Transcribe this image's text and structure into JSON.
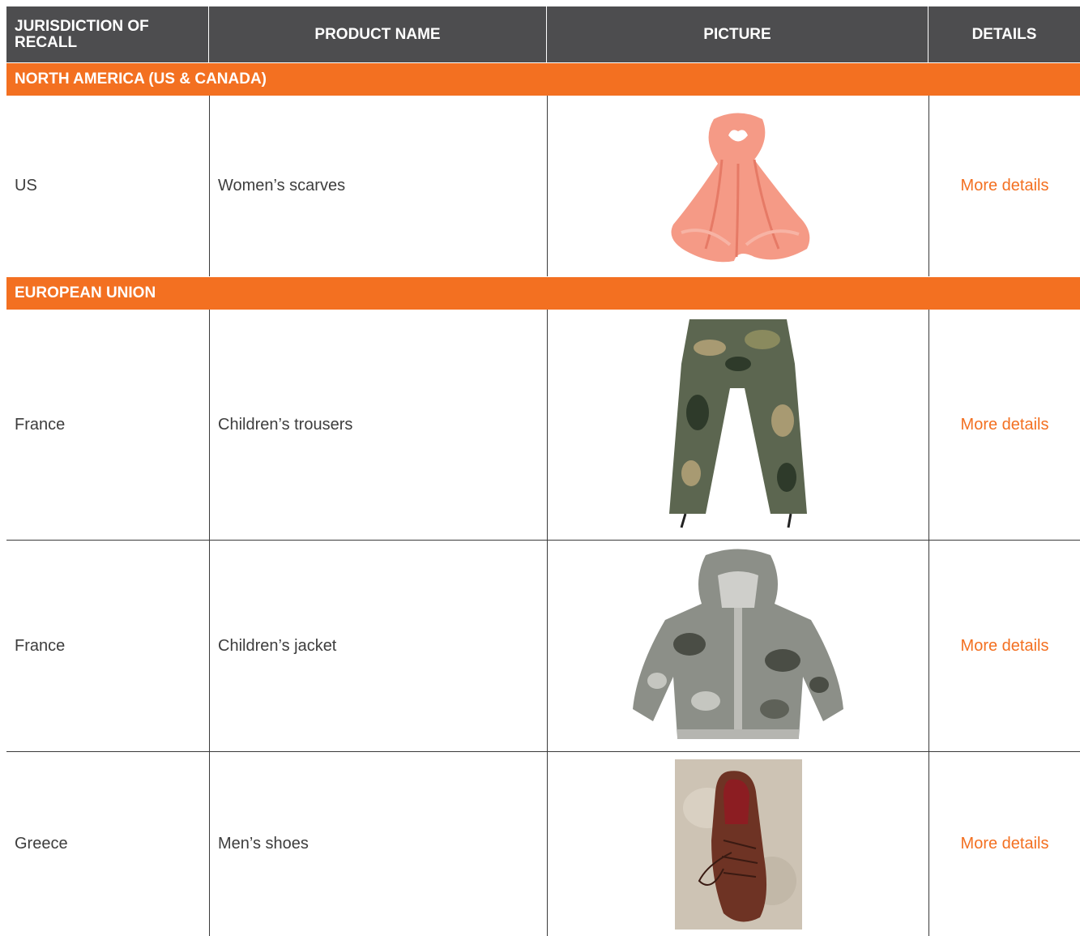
{
  "header": {
    "jurisdiction": "JURISDICTION OF\nRECALL",
    "product_name": "PRODUCT NAME",
    "picture": "PICTURE",
    "details": "DETAILS"
  },
  "sections": [
    {
      "title": "NORTH AMERICA (US & CANADA)",
      "rows": [
        {
          "jurisdiction": "US",
          "product": "Women’s scarves",
          "picture": "scarf-image",
          "details": "More details"
        }
      ]
    },
    {
      "title": "EUROPEAN UNION",
      "rows": [
        {
          "jurisdiction": "France",
          "product": "Children’s trousers",
          "picture": "camouflage-trousers-image",
          "details": "More details"
        },
        {
          "jurisdiction": "France",
          "product": "Children’s jacket",
          "picture": "camouflage-jacket-image",
          "details": "More details"
        },
        {
          "jurisdiction": "Greece",
          "product": "Men’s shoes",
          "picture": "brown-shoe-image",
          "details": "More details"
        }
      ]
    }
  ],
  "colors": {
    "header_bg": "#4d4d4f",
    "section_bg": "#f37021",
    "link": "#f37021",
    "text": "#3d3d3d"
  }
}
